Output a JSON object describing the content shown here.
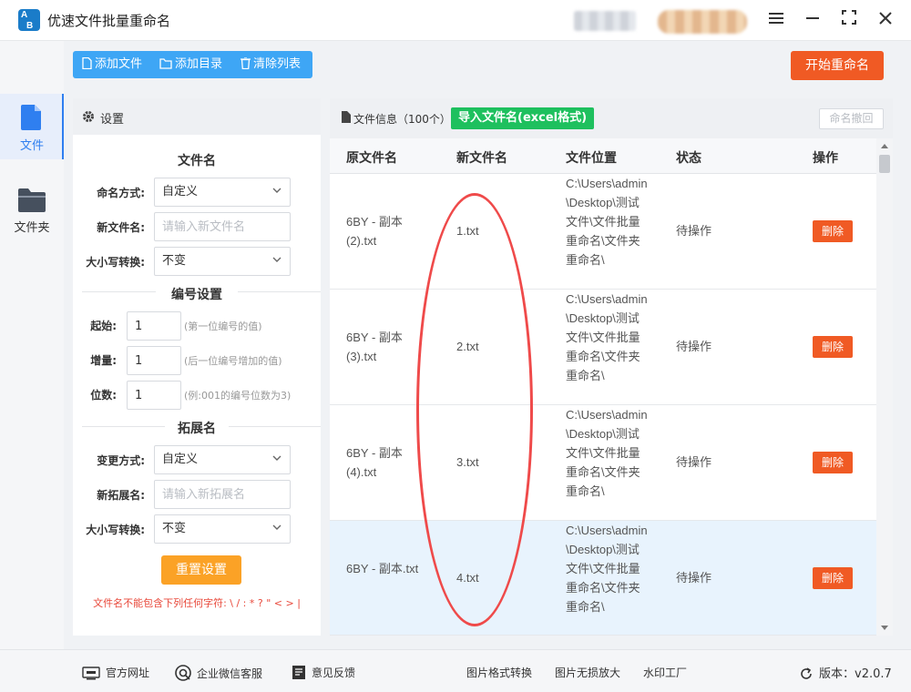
{
  "app": {
    "logo_text_top": "A",
    "logo_text_bottom": "B",
    "title": "优速文件批量重命名"
  },
  "sidebar": {
    "items": [
      {
        "label": "文件",
        "icon": "file-icon"
      },
      {
        "label": "文件夹",
        "icon": "folder-icon"
      }
    ]
  },
  "toolbar": {
    "add_file": "添加文件",
    "add_dir": "添加目录",
    "clear_list": "清除列表",
    "start_rename": "开始重命名"
  },
  "settings": {
    "title": "设置",
    "filename_section": "文件名",
    "naming_mode_label": "命名方式:",
    "naming_mode_value": "自定义",
    "new_name_label": "新文件名:",
    "new_name_placeholder": "请输入新文件名",
    "case_label": "大小写转换:",
    "case_value": "不变",
    "numbering_section": "编号设置",
    "start_label": "起始:",
    "start_value": "1",
    "start_hint": "(第一位编号的值)",
    "step_label": "增量:",
    "step_value": "1",
    "step_hint": "(后一位编号增加的值)",
    "digits_label": "位数:",
    "digits_value": "1",
    "digits_hint": "(例:001的编号位数为3)",
    "ext_section": "拓展名",
    "ext_mode_label": "变更方式:",
    "ext_mode_value": "自定义",
    "new_ext_label": "新拓展名:",
    "new_ext_placeholder": "请输入新拓展名",
    "ext_case_label": "大小写转换:",
    "ext_case_value": "不变",
    "reset_button": "重置设置",
    "warning": "文件名不能包含下列任何字符: \\ / : * ? \" < > |"
  },
  "file_panel": {
    "title": "文件信息（100个）",
    "import_button": "导入文件名(excel格式)",
    "undo_button": "命名撤回",
    "columns": [
      "原文件名",
      "新文件名",
      "文件位置",
      "状态",
      "操作"
    ],
    "rows": [
      {
        "original": "6BY - 副本 (2).txt",
        "new": "1.txt",
        "location": "C:\\Users\\admin\\Desktop\\测试文件\\文件批量重命名\\文件夹重命名\\",
        "status": "待操作",
        "action": "删除"
      },
      {
        "original": "6BY - 副本 (3).txt",
        "new": "2.txt",
        "location": "C:\\Users\\admin\\Desktop\\测试文件\\文件批量重命名\\文件夹重命名\\",
        "status": "待操作",
        "action": "删除"
      },
      {
        "original": "6BY - 副本 (4).txt",
        "new": "3.txt",
        "location": "C:\\Users\\admin\\Desktop\\测试文件\\文件批量重命名\\文件夹重命名\\",
        "status": "待操作",
        "action": "删除"
      },
      {
        "original": "6BY - 副本.txt",
        "new": "4.txt",
        "location": "C:\\Users\\admin\\Desktop\\测试文件\\文件批量重命名\\文件夹重命名\\",
        "status": "待操作",
        "action": "删除"
      }
    ]
  },
  "footer": {
    "official_site": "官方网址",
    "wechat_support": "企业微信客服",
    "feedback": "意见反馈",
    "image_convert": "图片格式转换",
    "image_enlarge": "图片无损放大",
    "watermark": "水印工厂",
    "version": "版本：v2.0.7"
  },
  "colors": {
    "accent_blue": "#3ea6f5",
    "start_orange": "#f05a24",
    "reset_orange": "#fba226",
    "import_green": "#1ec05e",
    "annotation_red": "#ef4a4a"
  }
}
